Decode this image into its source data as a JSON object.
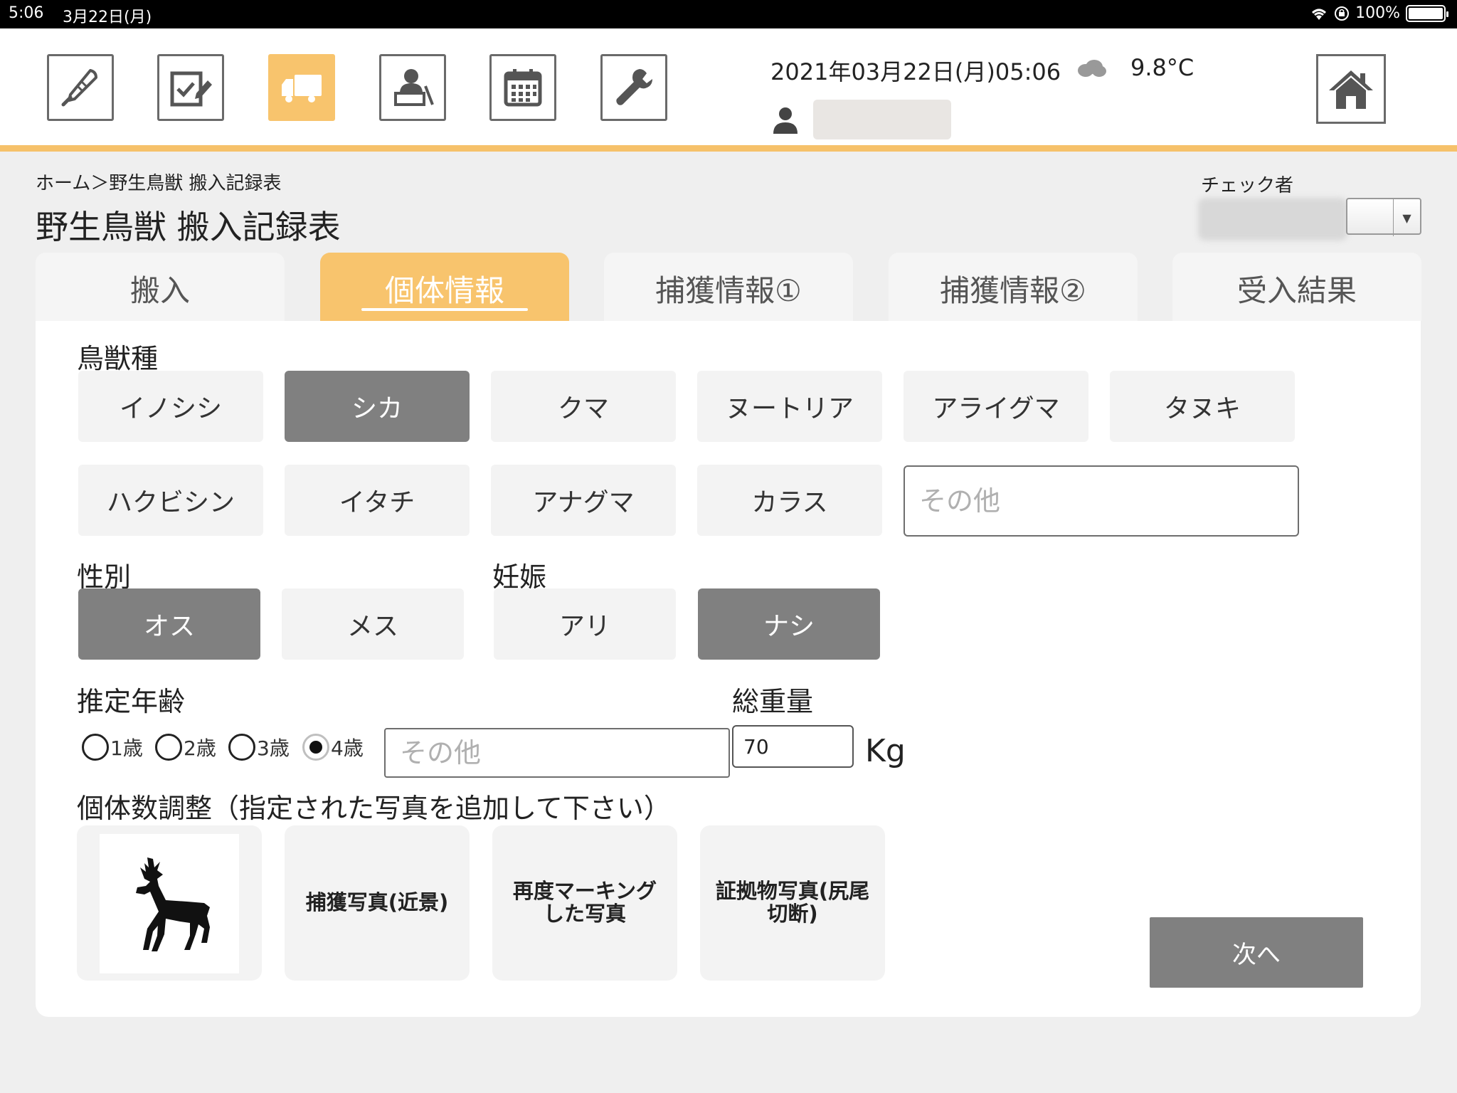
{
  "status_bar": {
    "time": "5:06",
    "date": "3月22日(月)",
    "battery": "100%"
  },
  "header": {
    "datetime": "2021年03月22日(月)05:06",
    "temperature": "9.8°C",
    "weather_icon": "cloud-icon",
    "tools": [
      {
        "name": "thermometer-icon",
        "active": false
      },
      {
        "name": "checklist-icon",
        "active": false
      },
      {
        "name": "truck-icon",
        "active": true
      },
      {
        "name": "worker-icon",
        "active": false
      },
      {
        "name": "calendar-icon",
        "active": false
      },
      {
        "name": "wrench-icon",
        "active": false
      }
    ],
    "home_icon": "home-icon"
  },
  "breadcrumb": "ホーム＞野生鳥獣 搬入記録表",
  "page_title": "野生鳥獣 搬入記録表",
  "checker": {
    "label": "チェック者"
  },
  "tabs": [
    {
      "label": "搬入"
    },
    {
      "label": "個体情報"
    },
    {
      "label": "捕獲情報①"
    },
    {
      "label": "捕獲情報②"
    },
    {
      "label": "受入結果"
    }
  ],
  "species": {
    "label": "鳥獣種",
    "options": [
      "イノシシ",
      "シカ",
      "クマ",
      "ヌートリア",
      "アライグマ",
      "タヌキ",
      "ハクビシン",
      "イタチ",
      "アナグマ",
      "カラス"
    ],
    "selected": "シカ",
    "other_placeholder": "その他"
  },
  "sex": {
    "label": "性別",
    "options": [
      "オス",
      "メス"
    ],
    "selected": "オス"
  },
  "pregnancy": {
    "label": "妊娠",
    "options": [
      "アリ",
      "ナシ"
    ],
    "selected": "ナシ"
  },
  "age": {
    "label": "推定年齢",
    "options": [
      "1歳",
      "2歳",
      "3歳",
      "4歳"
    ],
    "selected": "4歳",
    "other_placeholder": "その他"
  },
  "weight": {
    "label": "総重量",
    "value": "70",
    "unit": "Kg"
  },
  "count_adjust": {
    "label": "個体数調整（指定された写真を追加して下さい）",
    "photos": [
      "捕獲写真(近景)",
      "再度マーキングした写真",
      "証拠物写真(尻尾切断)"
    ]
  },
  "next_button": "次へ",
  "colors": {
    "accent": "#f8c46d",
    "selected": "#808080",
    "option_bg": "#f3f3f3"
  }
}
